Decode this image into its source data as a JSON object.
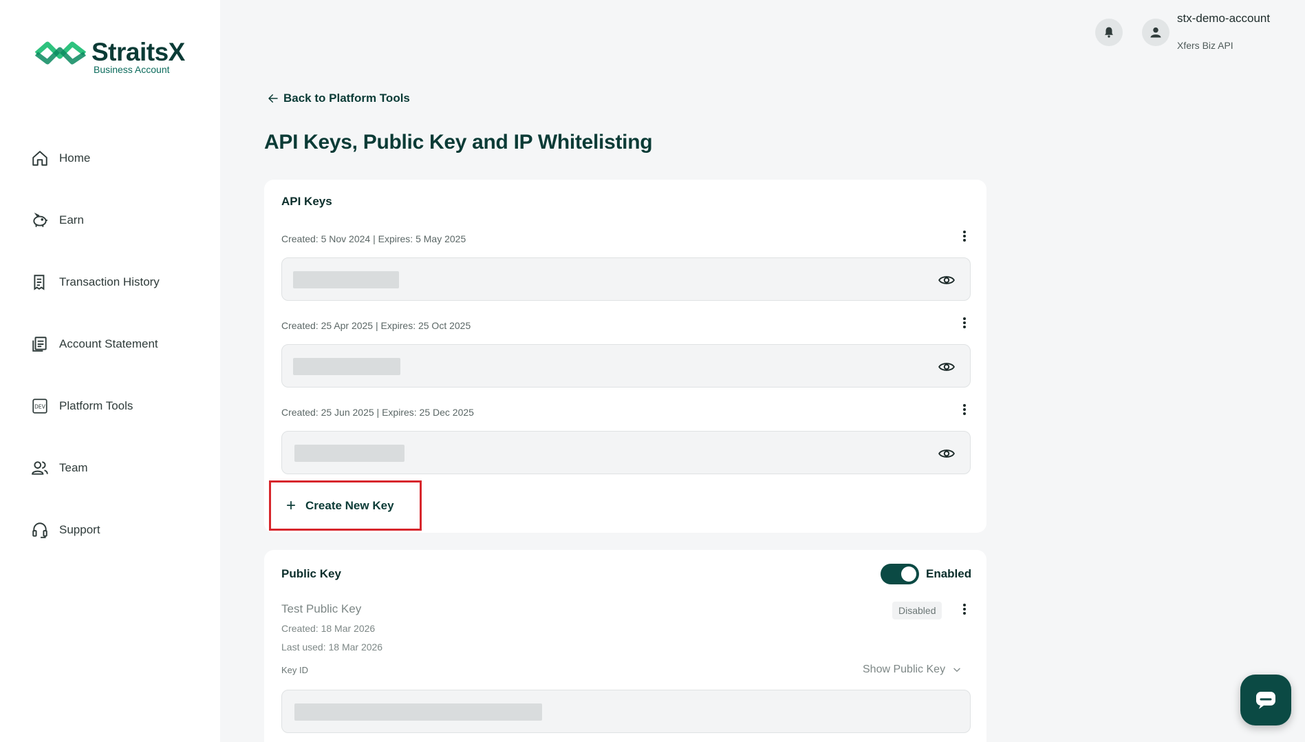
{
  "brand": {
    "name": "StraitsX",
    "subtitle": "Business Account",
    "color": "#0b3b36",
    "accent": "#2ec27e"
  },
  "sidebar": {
    "items": [
      {
        "label": "Home",
        "icon": "home-icon"
      },
      {
        "label": "Earn",
        "icon": "piggy-bank-icon"
      },
      {
        "label": "Transaction History",
        "icon": "receipt-icon"
      },
      {
        "label": "Account Statement",
        "icon": "document-icon"
      },
      {
        "label": "Platform Tools",
        "icon": "dev-icon"
      },
      {
        "label": "Team",
        "icon": "team-icon"
      },
      {
        "label": "Support",
        "icon": "headset-icon"
      }
    ]
  },
  "header": {
    "account_name": "stx-demo-account",
    "account_sub": "Xfers Biz API"
  },
  "main": {
    "back_label": "Back to Platform Tools",
    "title": "API Keys, Public Key and IP Whitelisting"
  },
  "api_keys": {
    "title": "API Keys",
    "keys": [
      {
        "meta": "Created: 5 Nov 2024 | Expires: 5 May 2025"
      },
      {
        "meta": "Created: 25 Apr 2025 | Expires: 25 Oct 2025"
      },
      {
        "meta": "Created: 25 Jun 2025 | Expires: 25 Dec 2025"
      }
    ],
    "create_label": "Create New Key"
  },
  "public_key": {
    "title": "Public Key",
    "toggle_label": "Enabled",
    "key_name": "Test Public Key",
    "created": "Created: 18 Mar 2026",
    "last_used": "Last used: 18 Mar 2026",
    "status_badge": "Disabled",
    "key_id_label": "Key ID",
    "show_label": "Show Public Key"
  },
  "colors": {
    "highlight": "#d7262c",
    "primary": "#0b4a44"
  }
}
